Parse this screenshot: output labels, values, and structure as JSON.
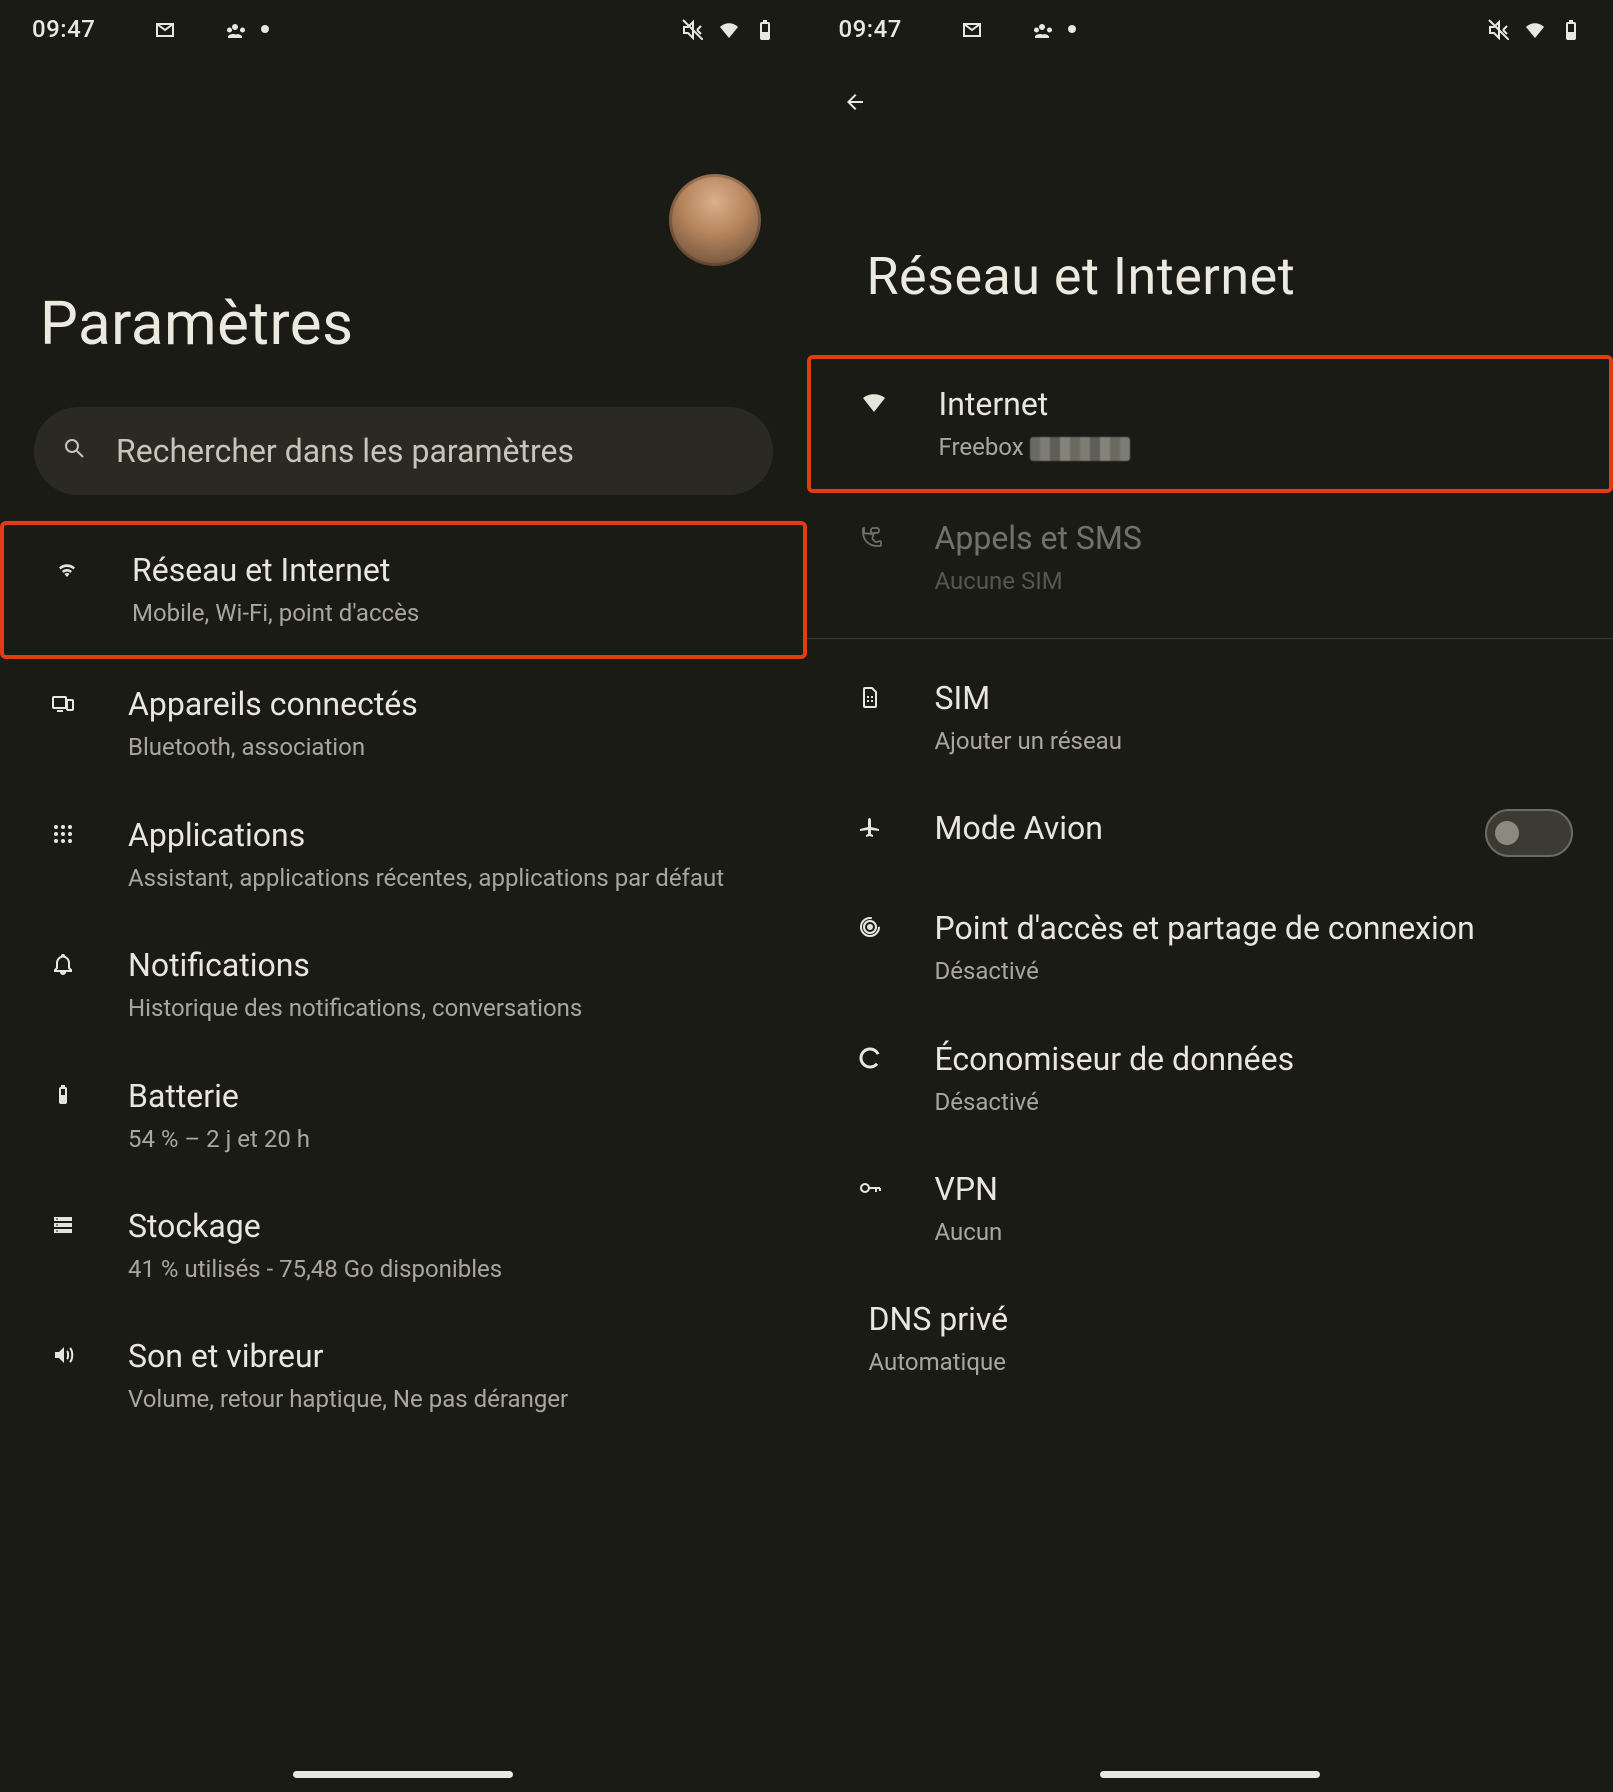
{
  "status": {
    "time": "09:47"
  },
  "left": {
    "title": "Paramètres",
    "search_placeholder": "Rechercher dans les paramètres",
    "items": [
      {
        "icon": "wifi-icon",
        "title": "Réseau et Internet",
        "sub": "Mobile, Wi-Fi, point d'accès"
      },
      {
        "icon": "devices-icon",
        "title": "Appareils connectés",
        "sub": "Bluetooth, association"
      },
      {
        "icon": "apps-icon",
        "title": "Applications",
        "sub": "Assistant, applications récentes, applications par défaut"
      },
      {
        "icon": "bell-icon",
        "title": "Notifications",
        "sub": "Historique des notifications, conversations"
      },
      {
        "icon": "battery-icon",
        "title": "Batterie",
        "sub": "54 % – 2 j et 20 h"
      },
      {
        "icon": "storage-icon",
        "title": "Stockage",
        "sub": "41 % utilisés - 75,48 Go disponibles"
      },
      {
        "icon": "sound-icon",
        "title": "Son et vibreur",
        "sub": "Volume, retour haptique, Ne pas déranger"
      }
    ]
  },
  "right": {
    "title": "Réseau et Internet",
    "items": [
      {
        "icon": "wifi-full-icon",
        "title": "Internet",
        "sub": "Freebox"
      },
      {
        "icon": "phone-msg-icon",
        "title": "Appels et SMS",
        "sub": "Aucune SIM"
      },
      {
        "icon": "sim-icon",
        "title": "SIM",
        "sub": "Ajouter un réseau"
      },
      {
        "icon": "airplane-icon",
        "title": "Mode Avion",
        "sub": ""
      },
      {
        "icon": "hotspot-icon",
        "title": "Point d'accès et partage de connexion",
        "sub": "Désactivé"
      },
      {
        "icon": "data-saver-icon",
        "title": "Économiseur de données",
        "sub": "Désactivé"
      },
      {
        "icon": "key-icon",
        "title": "VPN",
        "sub": "Aucun"
      },
      {
        "icon": "",
        "title": "DNS privé",
        "sub": "Automatique"
      }
    ]
  }
}
